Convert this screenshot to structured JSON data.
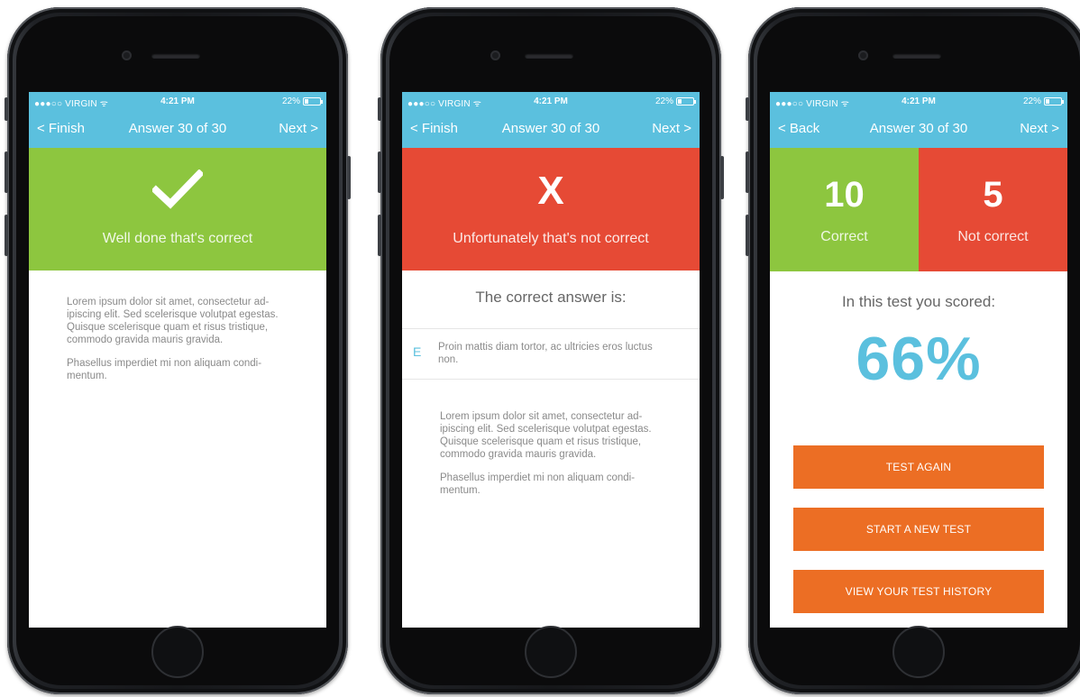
{
  "status_bar": {
    "carrier": "●●●○○ VIRGIN ᯤ",
    "time": "4:21 PM",
    "battery": "22%"
  },
  "phones": [
    {
      "nav": {
        "left": "< Finish",
        "title": "Answer 30 of 30",
        "right": "Next >"
      },
      "banner": {
        "message": "Well done that's correct",
        "icon": "checkmark-icon",
        "color": "#8dc63f"
      },
      "body": [
        "Lorem ipsum dolor sit amet, consectetur ad-ipiscing elit. Sed scelerisque volutpat egestas. Quisque scelerisque quam et risus tristique, commodo gravida mauris gravida.",
        "Phasellus imperdiet mi non aliquam condi-mentum."
      ]
    },
    {
      "nav": {
        "left": "< Finish",
        "title": "Answer 30 of 30",
        "right": "Next >"
      },
      "banner": {
        "mark": "X",
        "message": "Unfortunately that's not correct",
        "color": "#e64a35"
      },
      "correct_heading": "The correct answer is:",
      "answer": {
        "letter": "E",
        "text": "Proin mattis diam tortor, ac ultricies eros luctus non."
      },
      "body": [
        "Lorem ipsum dolor sit amet, consectetur ad-ipiscing elit. Sed scelerisque volutpat egestas. Quisque scelerisque quam et risus tristique, commodo gravida mauris gravida.",
        "Phasellus imperdiet mi non aliquam condi-mentum."
      ]
    },
    {
      "nav": {
        "left": "< Back",
        "title": "Answer 30 of 30",
        "right": "Next >"
      },
      "score": {
        "correct_count": "10",
        "correct_label": "Correct",
        "incorrect_count": "5",
        "incorrect_label": "Not correct",
        "scored_label": "In this test you scored:",
        "percent": "66%"
      },
      "buttons": {
        "test_again": "TEST AGAIN",
        "start_new": "START A NEW TEST",
        "view_history": "VIEW YOUR TEST HISTORY"
      }
    }
  ],
  "colors": {
    "accent_blue": "#5bc0de",
    "success_green": "#8dc63f",
    "error_red": "#e64a35",
    "button_orange": "#ec6e24"
  }
}
